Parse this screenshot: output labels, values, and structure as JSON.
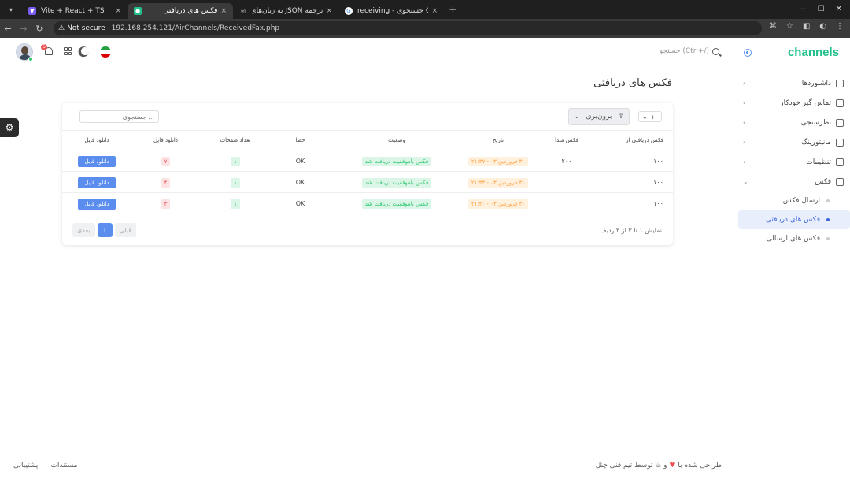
{
  "browser": {
    "tabs": [
      {
        "title": "Vite + React + TS",
        "active": false
      },
      {
        "title": "فکس های دریافتی",
        "active": true
      },
      {
        "title": "ترجمه JSON به زبان‌های م",
        "active": false
      },
      {
        "title": "receiving - جستجوی Goo",
        "active": false
      }
    ],
    "new_tab": "+",
    "not_secure": "Not secure",
    "url": "192.168.254.121/AirChannels/ReceivedFax.php"
  },
  "brand": "channels",
  "sidebar": {
    "items": [
      {
        "label": "داشبوردها",
        "icon": "home-icon"
      },
      {
        "label": "تماس گیر خودکار",
        "icon": "phone-icon"
      },
      {
        "label": "نظرسنجی",
        "icon": "survey-icon"
      },
      {
        "label": "مانیتورینگ",
        "icon": "monitor-icon"
      },
      {
        "label": "تنظیمات",
        "icon": "settings-icon"
      },
      {
        "label": "فکس",
        "icon": "fax-icon"
      }
    ],
    "subitems": [
      {
        "label": "ارسال فکس",
        "active": false
      },
      {
        "label": "فکس های دریافتی",
        "active": true
      },
      {
        "label": "فکس های ارسالی",
        "active": false
      }
    ]
  },
  "header": {
    "search_hint": "جستجو (Ctrl+/)",
    "notification_count": "5"
  },
  "page_title": "فکس های دریافتی",
  "table_controls": {
    "per_page": "۱۰",
    "export_label": "برون‌بری",
    "search_placeholder": "جستجوی ..."
  },
  "columns": [
    "فکس دریافتی از",
    "فکس مبدا",
    "تاریخ",
    "وضعیت",
    "خطا",
    "تعداد صفحات",
    "دانلود فایل",
    "دانلود فایل"
  ],
  "rows": [
    {
      "from": "۱۰۰",
      "origin": "۲۰۰",
      "date": "۳۰ فروردین ۰۳ - ۲۱:۳۷",
      "status": "فکس باموفقیت دریافت شد",
      "error": "OK",
      "pages": "۱",
      "count": "۷",
      "download": "دانلود فایل"
    },
    {
      "from": "۱۰۰",
      "origin": "",
      "date": "۳۰ فروردین ۰۳ - ۲۱:۳۳",
      "status": "فکس باموفقیت دریافت شد",
      "error": "OK",
      "pages": "۱",
      "count": "۴",
      "download": "دانلود فایل"
    },
    {
      "from": "۱۰۰",
      "origin": "",
      "date": "۳۰ فروردین ۰۳ - ۲۱:۳۰",
      "status": "فکس باموفقیت دریافت شد",
      "error": "OK",
      "pages": "۱",
      "count": "۳",
      "download": "دانلود فایل"
    }
  ],
  "pagination": {
    "info": "نمایش ۱ تا ۳ از ۳ ردیف",
    "prev": "قبلی",
    "current": "1",
    "next": "بعدی"
  },
  "footer": {
    "credit_pre": "طراحی شده با",
    "credit_post": "و ☕ توسط تیم فنی چنل",
    "docs": "مستندات",
    "support": "پشتیبانی"
  },
  "colors": {
    "brand": "#22c08a",
    "primary": "#5a8dee",
    "warning": "#ff9f43",
    "success": "#28c76f",
    "danger": "#ea5455"
  }
}
